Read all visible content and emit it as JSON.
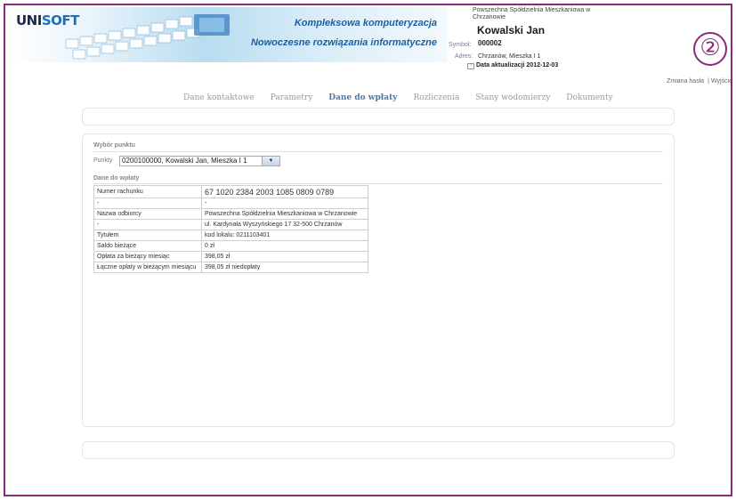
{
  "header": {
    "logo_part1": "UNI",
    "logo_part2": "SOFT",
    "slogan_line1": "Kompleksowa komputeryzacja",
    "slogan_line2": "Nowoczesne rozwiązania informatyczne"
  },
  "client": {
    "coop_name": "Powszechna Spółdzielnia Mieszkaniowa w Chrzanowie",
    "name": "Kowalski Jan",
    "symbol_label": "Symbol:",
    "symbol_value": "000002",
    "address_label": "Adres:",
    "address_value": "Chrzanów, Mieszka I 1",
    "update_icon": "?",
    "update_text": "Data aktualizacji 2012-12-03"
  },
  "badge": "②",
  "toplinks": {
    "change_password": "Zmiana hasła",
    "separator": "|",
    "logout": "Wyjście"
  },
  "tabs": [
    {
      "label": "Dane kontaktowe"
    },
    {
      "label": "Parametry"
    },
    {
      "label": "Dane do wpłaty"
    },
    {
      "label": "Rozliczenia"
    },
    {
      "label": "Stany wodomierzy"
    },
    {
      "label": "Dokumenty"
    }
  ],
  "active_tab": "Dane do wpłaty",
  "point_section": {
    "title": "Wybór punktu",
    "label": "Punkty",
    "selected": "0200100000, Kowalski Jan, Mieszka I 1"
  },
  "payment_section": {
    "title": "Dane do wpłaty",
    "rows": [
      {
        "key": "Numer rachunku",
        "value": "67 1020 2384 2003 1085 0809 0789"
      },
      {
        "key": "-",
        "value": "-"
      },
      {
        "key": "Nazwa odbiorcy",
        "value": "Powszechna Spółdzielnia Mieszkaniowa w Chrzanowie"
      },
      {
        "key": "-",
        "value": "ul. Kardynała Wyszyńskiego 17 32-500 Chrzanów"
      },
      {
        "key": "Tytułem",
        "value": "kod lokalu: 0211103401"
      },
      {
        "key": "Saldo bieżące",
        "value": "0 zł"
      },
      {
        "key": "Opłata za bieżący miesiąc",
        "value": "398,05 zł"
      },
      {
        "key": "Łączne opłaty w bieżącym miesiącu",
        "value": "398,05 zł niedopłaty"
      }
    ]
  },
  "colors": {
    "frame": "#8a2a7a",
    "active_tab": "#4b79a8",
    "brand_blue": "#1d5fa6"
  }
}
